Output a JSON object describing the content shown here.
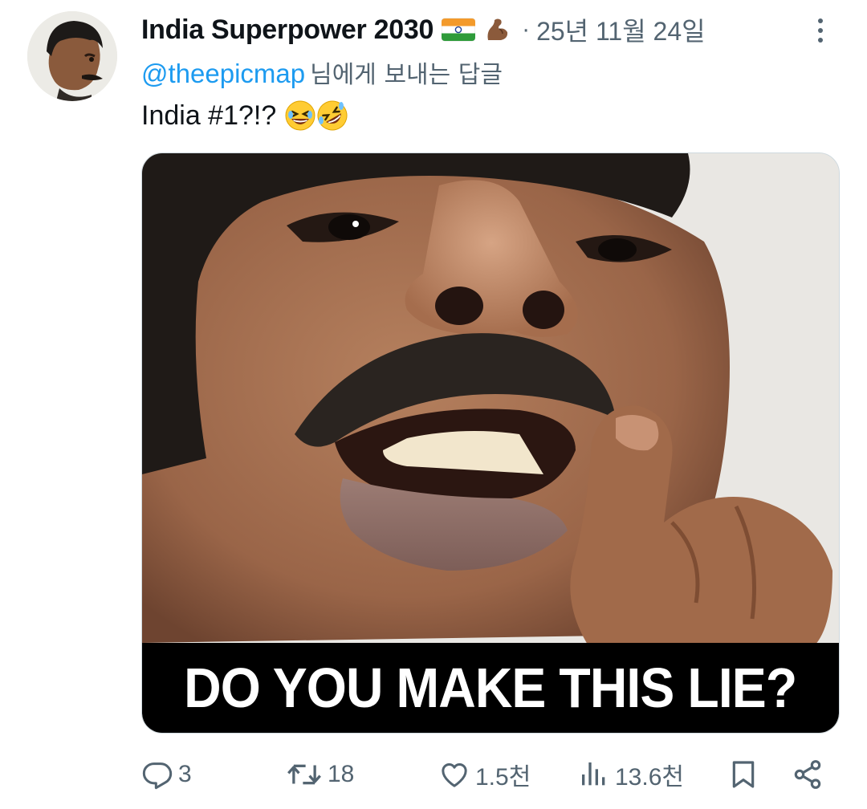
{
  "tweet": {
    "author_name": "India Superpower 2030",
    "date": "25년 11월 24일",
    "separator": "·",
    "reply_mention": "@theepicmap",
    "reply_suffix": "님에게 보내는 답글",
    "text": "India #1?!?",
    "image_caption": "DO YOU MAKE THIS LIE?"
  },
  "actions": {
    "replies": "3",
    "reposts": "18",
    "likes": "1.5천",
    "views": "13.6천"
  },
  "icons": {
    "author_badges": [
      "india-flag-icon",
      "flexed-biceps-icon"
    ],
    "text_emojis": [
      "grinning-squinting-face-icon",
      "rolling-on-floor-laughing-icon"
    ],
    "action_icons": [
      "reply-icon",
      "repost-icon",
      "like-icon",
      "views-icon",
      "bookmark-icon",
      "share-icon"
    ]
  },
  "colors": {
    "text_primary": "#0f1419",
    "text_secondary": "#536471",
    "link": "#1d9bf0"
  }
}
